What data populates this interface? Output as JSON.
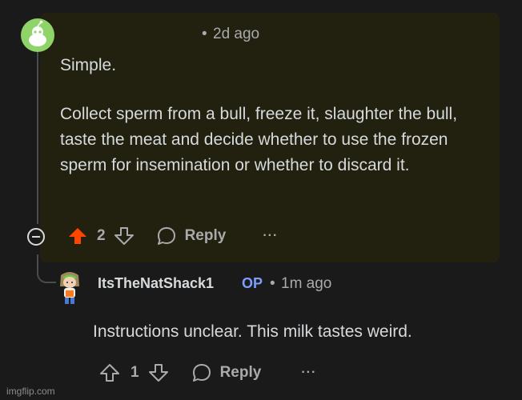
{
  "comment1": {
    "dot": "•",
    "time": "2d ago",
    "paragraph1": "Simple.",
    "paragraph2": "Collect sperm from a bull, freeze it, slaughter the bull, taste the meat and decide whether to use the frozen sperm for insemination or whether to discard it.",
    "upvote_count": "2",
    "reply_label": "Reply",
    "more_label": "···"
  },
  "comment2": {
    "username": "ItsTheNatShack1",
    "op_badge": "OP",
    "dot": "•",
    "time": "1m ago",
    "text": "Instructions unclear. This milk tastes weird.",
    "vote_count": "1",
    "reply_label": "Reply",
    "more_label": "···"
  },
  "watermark": "imgflip.com",
  "colors": {
    "background": "#1a1a1b",
    "highlight_card": "#22200f",
    "upvote_active": "#ff4500",
    "op_badge": "#7d9eff",
    "avatar_green": "#8fd468"
  }
}
